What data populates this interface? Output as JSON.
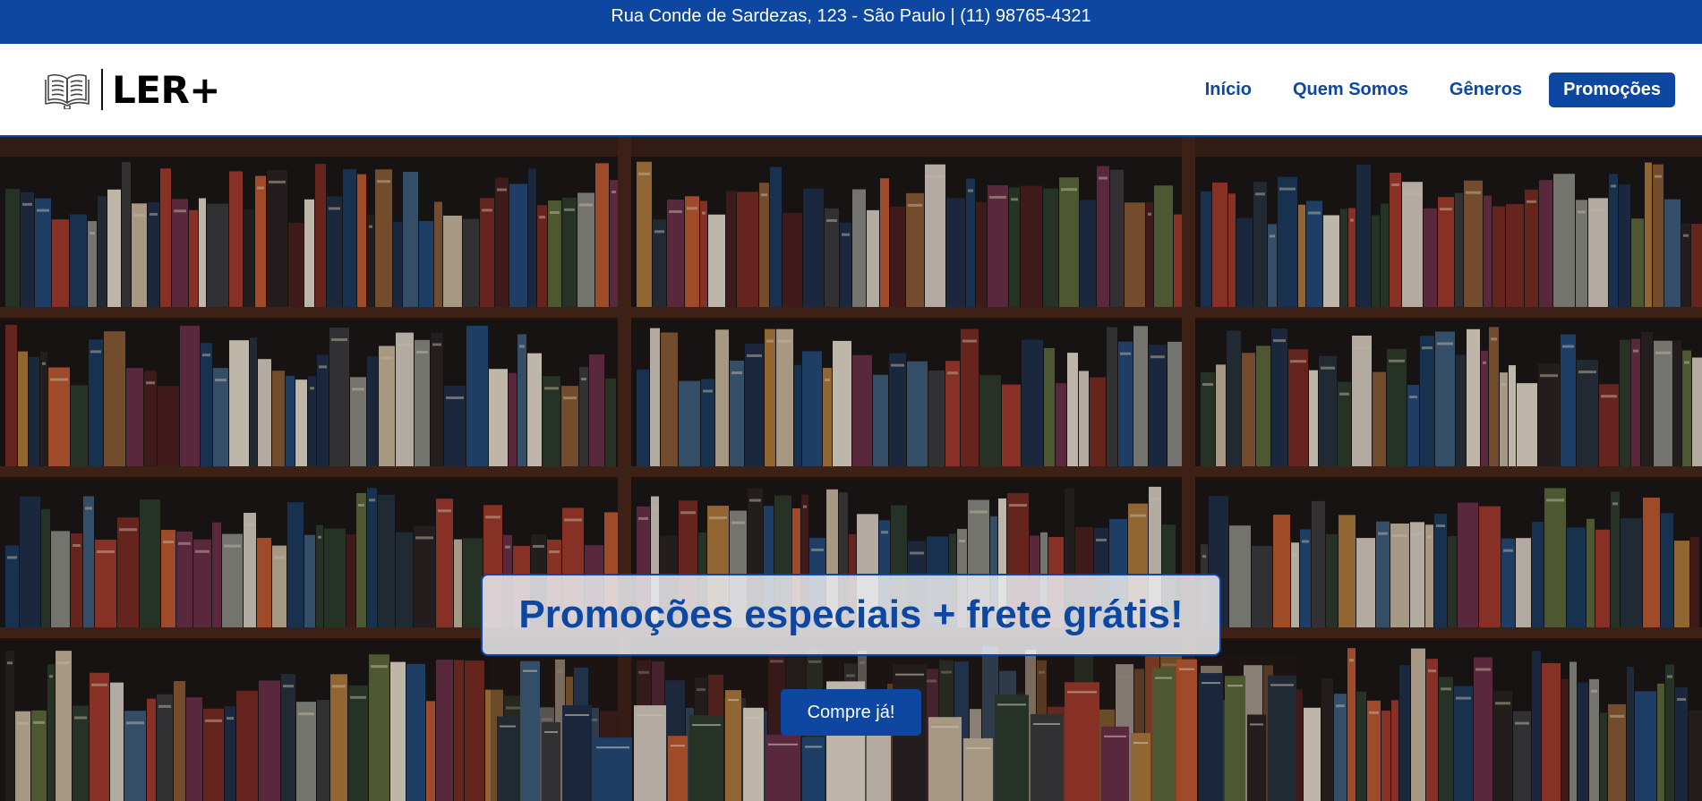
{
  "topbar": {
    "text": "Rua Conde de Sardezas, 123 - São Paulo | (11) 98765-4321"
  },
  "header": {
    "logo_icon": "open-book-icon",
    "logo_text": "LER+",
    "nav": [
      {
        "label": "Início",
        "active": false
      },
      {
        "label": "Quem Somos",
        "active": false
      },
      {
        "label": "Gêneros",
        "active": false
      },
      {
        "label": "Promoções",
        "active": true
      }
    ]
  },
  "hero": {
    "background": "bookshelf-photo",
    "title": "Promoções especiais + frete grátis!",
    "cta_label": "Compre já!"
  },
  "colors": {
    "brand": "#0d47a1",
    "white": "#ffffff",
    "promo_box_bg": "#e8e8ec"
  }
}
